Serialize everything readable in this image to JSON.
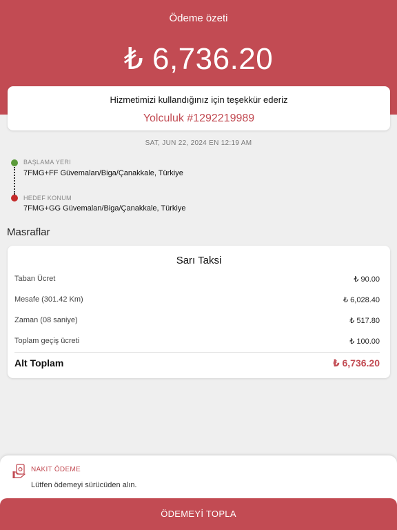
{
  "header": {
    "title": "Ödeme özeti",
    "total_amount": "₺ 6,736.20"
  },
  "thanks_card": {
    "message": "Hizmetimizi kullandığınız için teşekkür ederiz",
    "trip_id": "Yolculuk #1292219989"
  },
  "trip_date": "SAT, JUN 22, 2024 EN 12:19 AM",
  "route": {
    "start_label": "BAŞLAMA YERI",
    "start_address": "7FMG+FF Güvemalan/Biga/Çanakkale, Türkiye",
    "end_label": "HEDEF KONUM",
    "end_address": "7FMG+GG Güvemalan/Biga/Çanakkale, Türkiye"
  },
  "expenses": {
    "section_title": "Masraflar",
    "vehicle_type": "Sarı Taksi",
    "rows": [
      {
        "label": "Taban Ücret",
        "value": "₺ 90.00"
      },
      {
        "label": "Mesafe (301.42 Km)",
        "value": "₺ 6,028.40"
      },
      {
        "label": "Zaman (08 saniye)",
        "value": "₺ 517.80"
      },
      {
        "label": "Toplam geçiş ücreti",
        "value": "₺ 100.00"
      }
    ],
    "subtotal_label": "Alt Toplam",
    "subtotal_value": "₺ 6,736.20"
  },
  "payment": {
    "icon": "cash-payment-icon",
    "method_title": "NAKIT ÖDEME",
    "method_desc": "Lütfen ödemeyi sürücüden alın.",
    "collect_button": "ÖDEMEYİ TOPLA"
  },
  "colors": {
    "accent": "#c24b53",
    "start_dot": "#5a9a3a",
    "end_dot": "#c42a2a",
    "background": "#efefef"
  }
}
